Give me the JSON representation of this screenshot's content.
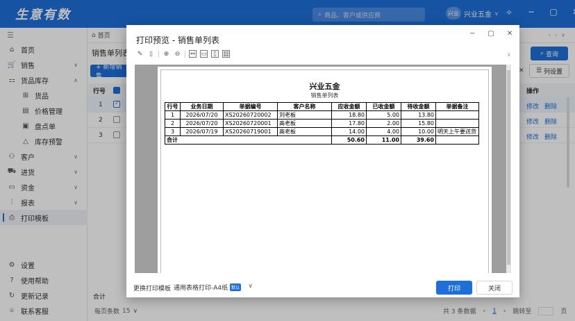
{
  "app": {
    "logo": "生意有数",
    "search_placeholder": "商品、客户或供应商",
    "user_avatar": "兴业",
    "user_name": "兴业五金",
    "accent": "#1e6fd9"
  },
  "window_controls": {
    "theme": "⟡",
    "minimize": "−",
    "maximize": "▢",
    "close": "✕"
  },
  "sidebar": {
    "items": [
      {
        "label": "首页",
        "icon": "home-icon",
        "glyph": "⌂"
      },
      {
        "label": "销售",
        "icon": "cart-icon",
        "glyph": "🛒",
        "chev": "∨"
      },
      {
        "label": "货品库存",
        "icon": "inventory-icon",
        "glyph": "⚏",
        "chev": "∧"
      },
      {
        "label": "货品",
        "icon": "grid-icon",
        "glyph": "⊞",
        "sub": true
      },
      {
        "label": "价格管理",
        "icon": "price-icon",
        "glyph": "▤",
        "sub": true
      },
      {
        "label": "盘点单",
        "icon": "checklist-icon",
        "glyph": "▣",
        "sub": true
      },
      {
        "label": "库存预警",
        "icon": "warning-icon",
        "glyph": "△",
        "sub": true
      },
      {
        "label": "客户",
        "icon": "customers-icon",
        "glyph": "⚇",
        "chev": "∨"
      },
      {
        "label": "进货",
        "icon": "truck-icon",
        "glyph": "⛟",
        "chev": "∨"
      },
      {
        "label": "资金",
        "icon": "wallet-icon",
        "glyph": "▭",
        "chev": "∨"
      },
      {
        "label": "报表",
        "icon": "chart-icon",
        "glyph": "⫶",
        "chev": "∨"
      },
      {
        "label": "打印模板",
        "icon": "printer-icon",
        "glyph": "⎙",
        "active": true
      }
    ],
    "bottom": [
      {
        "label": "设置",
        "icon": "settings-icon",
        "glyph": "⚙"
      },
      {
        "label": "使用帮助",
        "icon": "help-icon",
        "glyph": "?"
      },
      {
        "label": "更新记录",
        "icon": "history-icon",
        "glyph": "↻"
      },
      {
        "label": "联系客服",
        "icon": "chat-icon",
        "glyph": "⌾"
      }
    ]
  },
  "main": {
    "tab_home": "首页",
    "title": "销售单列表",
    "new_button": "+ 新增销售",
    "query_button": "查询",
    "colset_button": "列设置",
    "table_header": {
      "row_no": "行号",
      "ops": "操作"
    },
    "rows": [
      {
        "idx": "1",
        "edit": "修改",
        "del": "删除"
      },
      {
        "idx": "2",
        "edit": "修改",
        "del": "删除"
      },
      {
        "idx": "3",
        "edit": "修改",
        "del": "删除"
      }
    ],
    "total_label": "合计",
    "pager": {
      "per_page_label": "每页条数",
      "per_page": "15",
      "total": "共 3 条数据",
      "page": "1",
      "goto": "跳转至",
      "page_unit": "页"
    }
  },
  "dialog": {
    "title": "打印预览 - 销售单列表",
    "doc": {
      "company": "兴业五金",
      "subtitle": "销售单列表",
      "headers": [
        "行号",
        "业务日期",
        "单据编号",
        "客户名称",
        "应收金额",
        "已收金额",
        "待收金额",
        "单据备注"
      ],
      "rows": [
        [
          "1",
          "2026/07/20",
          "XS20260720002",
          "刘老板",
          "18.80",
          "5.00",
          "13.80",
          ""
        ],
        [
          "2",
          "2026/07/20",
          "XS20260720001",
          "高老板",
          "17.80",
          "2.00",
          "15.80",
          ""
        ],
        [
          "3",
          "2026/07/19",
          "XS20260719001",
          "高老板",
          "14.00",
          "4.00",
          "10.00",
          "明天上午要送货"
        ]
      ],
      "total": {
        "label": "合计",
        "receivable": "50.60",
        "received": "11.00",
        "pending": "39.60"
      }
    },
    "footer": {
      "template_label": "更换打印模板",
      "template_value": "通用表格打印-A4纸",
      "template_badge": "默认",
      "print_button": "打印",
      "close_button": "关闭"
    }
  }
}
